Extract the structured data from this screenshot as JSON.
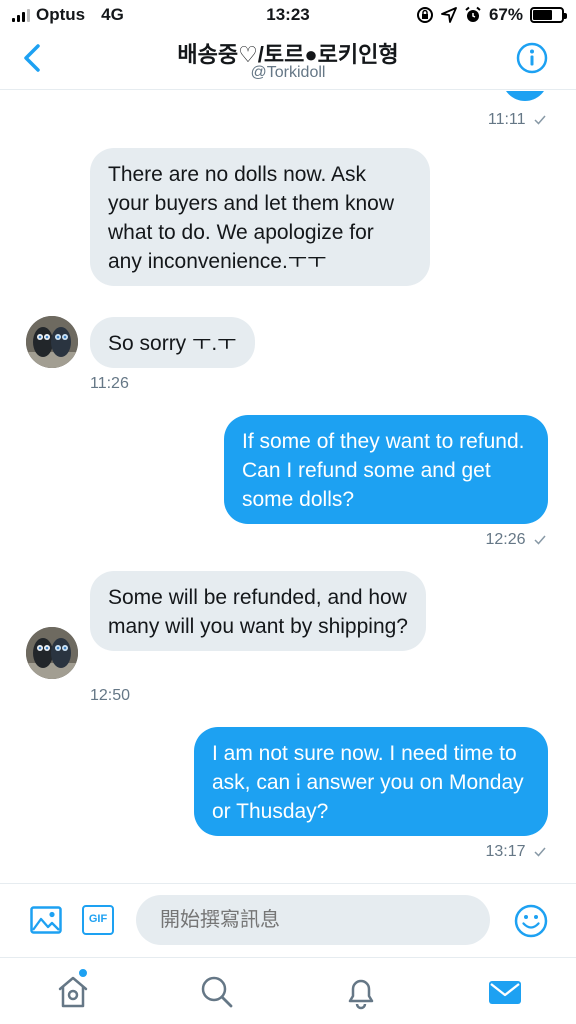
{
  "status_bar": {
    "carrier": "Optus",
    "network": "4G",
    "time": "13:23",
    "battery_percent": "67%",
    "battery_level": 0.67,
    "icons": [
      "orientation-lock-icon",
      "location-arrow-icon",
      "alarm-icon"
    ]
  },
  "header": {
    "title": "배송중♡/토르●로키인형",
    "handle": "@Torkidoll"
  },
  "messages": [
    {
      "direction": "out",
      "text": "",
      "timestamp": "11:11"
    },
    {
      "direction": "in",
      "text": "There are no dolls now. Ask your buyers and let them know what to do. We apologize for any inconvenience.ㅜㅜ"
    },
    {
      "direction": "in",
      "text": "So sorry ㅜ.ㅜ",
      "timestamp": "11:26"
    },
    {
      "direction": "out",
      "text": "If some of they want to refund. Can I refund some and get some dolls?",
      "timestamp": "12:26"
    },
    {
      "direction": "in",
      "text": "Some will be refunded, and how many will you want by shipping?",
      "timestamp": "12:50"
    },
    {
      "direction": "out",
      "text": "I  am not sure now. I need time to ask, can i answer you on Monday or Thusday?",
      "timestamp": "13:17"
    }
  ],
  "composer": {
    "placeholder": "開始撰寫訊息",
    "gif_label": "GIF"
  },
  "tab_bar": {
    "items": [
      "home-icon",
      "search-icon",
      "notifications-icon",
      "messages-icon"
    ],
    "active": "messages-icon"
  },
  "colors": {
    "accent": "#1da1f2",
    "incoming_bubble": "#e6ecf0",
    "secondary_text": "#657786"
  }
}
